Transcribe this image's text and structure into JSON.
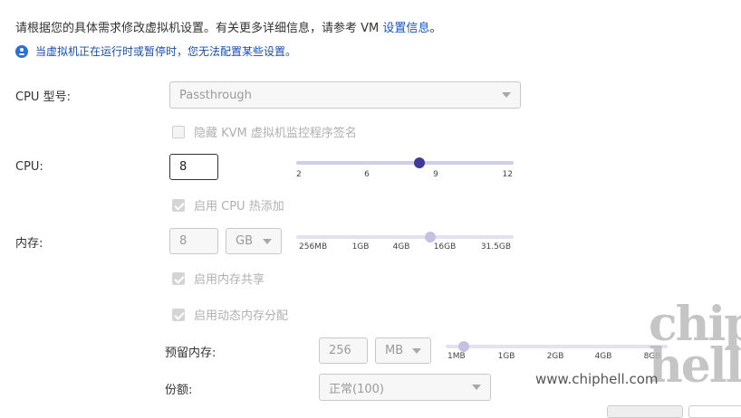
{
  "intro": {
    "text": "请根据您的具体需求修改虚拟机设置。有关更多详细信息，请参考 VM ",
    "link": "设置信息",
    "end": "。"
  },
  "notice": "当虚拟机正在运行时或暂停时，您无法配置某些设置。",
  "cpu_model": {
    "label": "CPU 型号:",
    "value": "Passthrough"
  },
  "hide_kvm": {
    "label": "隐藏 KVM 虚拟机监控程序签名",
    "checked": false
  },
  "cpu": {
    "label": "CPU:",
    "value": "8",
    "ticks": [
      "2",
      "6",
      "9",
      "12"
    ],
    "slider_fraction": 0.6
  },
  "cpu_hotplug": {
    "label": "启用 CPU 热添加",
    "checked": true
  },
  "memory": {
    "label": "内存:",
    "value": "8",
    "unit": "GB",
    "ticks": [
      "256MB",
      "1GB",
      "4GB",
      "16GB",
      "31.5GB"
    ],
    "slider_fraction": 0.62
  },
  "mem_share": {
    "label": "启用内存共享",
    "checked": true
  },
  "mem_dynamic": {
    "label": "启用动态内存分配",
    "checked": true
  },
  "reserved": {
    "label": "预留内存:",
    "value": "256",
    "unit": "MB",
    "ticks": [
      "1MB",
      "1GB",
      "2GB",
      "4GB",
      "8GB"
    ],
    "slider_fraction": 0.07
  },
  "shares": {
    "label": "份额:",
    "value": "正常(100)"
  },
  "watermark": {
    "logo": "chip hell",
    "url": "www.chiphell.com"
  },
  "colors": {
    "accent": "#3f3a99",
    "link": "#1a56c5"
  }
}
